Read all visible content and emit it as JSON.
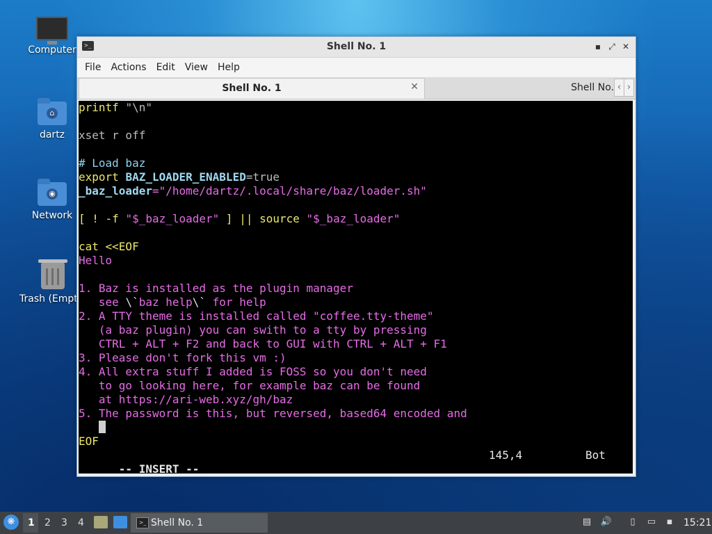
{
  "desktop": {
    "icons": [
      {
        "label": "Computer",
        "icon": "computer-icon"
      },
      {
        "label": "dartz",
        "icon": "home-folder-icon"
      },
      {
        "label": "Network",
        "icon": "network-folder-icon"
      },
      {
        "label": "Trash (Empty)",
        "icon": "trash-icon"
      }
    ]
  },
  "window": {
    "title": "Shell No. 1",
    "controls": {
      "minimize": "▪",
      "maximize": "⤢",
      "close": "✕"
    },
    "menu": [
      "File",
      "Actions",
      "Edit",
      "View",
      "Help"
    ],
    "tabs": [
      {
        "label": "Shell No. 1",
        "active": true,
        "close": "✕"
      },
      {
        "label": "Shell No.",
        "active": false
      }
    ],
    "tab_nav": {
      "left": "‹",
      "right": "›"
    }
  },
  "terminal": {
    "lines": [
      {
        "segments": [
          {
            "t": "printf ",
            "c": "y"
          },
          {
            "t": "\"\\n\"",
            "c": "g"
          }
        ]
      },
      {
        "segments": []
      },
      {
        "segments": [
          {
            "t": "xset r off",
            "c": "g"
          }
        ]
      },
      {
        "segments": []
      },
      {
        "segments": [
          {
            "t": "# Load baz",
            "c": "c"
          }
        ]
      },
      {
        "segments": [
          {
            "t": "export ",
            "c": "y"
          },
          {
            "t": "BAZ_LOADER_ENABLED",
            "c": "cb"
          },
          {
            "t": "=true",
            "c": "g"
          }
        ]
      },
      {
        "segments": [
          {
            "t": "_baz_loader",
            "c": "cb"
          },
          {
            "t": "=\"/home/dartz/.local/share/baz/loader.sh\"",
            "c": "p"
          }
        ]
      },
      {
        "segments": []
      },
      {
        "segments": [
          {
            "t": "[ ! -f ",
            "c": "y"
          },
          {
            "t": "\"$_baz_loader\"",
            "c": "p"
          },
          {
            "t": " ] || ",
            "c": "y"
          },
          {
            "t": "source ",
            "c": "y"
          },
          {
            "t": "\"$_baz_loader\"",
            "c": "p"
          }
        ]
      },
      {
        "segments": []
      },
      {
        "segments": [
          {
            "t": "cat <<EOF",
            "c": "y"
          }
        ]
      },
      {
        "segments": [
          {
            "t": "Hello",
            "c": "p"
          }
        ]
      },
      {
        "segments": []
      },
      {
        "segments": [
          {
            "t": "1. Baz is installed as the plugin manager",
            "c": "p"
          }
        ]
      },
      {
        "segments": [
          {
            "t": "   see ",
            "c": "p"
          },
          {
            "t": "\\`",
            "c": "w"
          },
          {
            "t": "baz help",
            "c": "p"
          },
          {
            "t": "\\`",
            "c": "w"
          },
          {
            "t": " for help",
            "c": "p"
          }
        ]
      },
      {
        "segments": [
          {
            "t": "2. A TTY theme is installed called \"coffee.tty-theme\"",
            "c": "p"
          }
        ]
      },
      {
        "segments": [
          {
            "t": "   (a baz plugin) you can swith to a tty by pressing",
            "c": "p"
          }
        ]
      },
      {
        "segments": [
          {
            "t": "   CTRL + ALT + F2 and back to GUI with CTRL + ALT + F1",
            "c": "p"
          }
        ]
      },
      {
        "segments": [
          {
            "t": "3. Please don't fork this vm :)",
            "c": "p"
          }
        ]
      },
      {
        "segments": [
          {
            "t": "4. All extra stuff I added is FOSS so you don't need",
            "c": "p"
          }
        ]
      },
      {
        "segments": [
          {
            "t": "   to go looking here, for example baz can be found",
            "c": "p"
          }
        ]
      },
      {
        "segments": [
          {
            "t": "   at https://ari-web.xyz/gh/baz",
            "c": "p"
          }
        ]
      },
      {
        "segments": [
          {
            "t": "5. The password is this, but reversed, based64 encoded and",
            "c": "p"
          }
        ]
      },
      {
        "segments": [
          {
            "t": "   ",
            "c": "p"
          }
        ],
        "cursor": true
      },
      {
        "segments": [
          {
            "t": "EOF",
            "c": "y"
          }
        ]
      }
    ],
    "status": {
      "mode": "-- INSERT --",
      "position": "145,4",
      "scroll": "Bot"
    }
  },
  "taskbar": {
    "start_icon": "start-menu-icon",
    "workspaces": [
      "1",
      "2",
      "3",
      "4"
    ],
    "active_workspace": "1",
    "task_label": "Shell No. 1",
    "clock": "15:21",
    "tray_icons": [
      "clipboard-icon",
      "volume-icon",
      "notes-icon",
      "screen-icon",
      "network-icon"
    ]
  }
}
